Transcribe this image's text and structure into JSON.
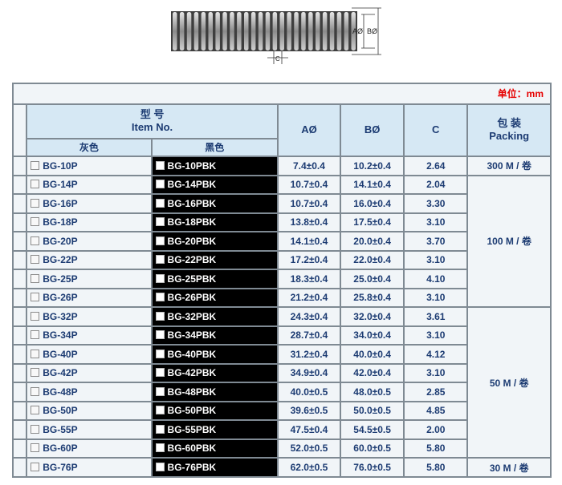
{
  "drawing": {
    "label_a": "AØ",
    "label_b": "BØ",
    "label_c": "C"
  },
  "table": {
    "unit": "单位：mm",
    "header": {
      "item_title_cn": "型  号",
      "item_title_en": "Item No.",
      "gray": "灰色",
      "black": "黑色",
      "a": "AØ",
      "b": "BØ",
      "c": "C",
      "packing_cn": "包  装",
      "packing_en": "Packing"
    },
    "rows": [
      {
        "gray": "BG-10P",
        "black": "BG-10PBK",
        "a": "7.4±0.4",
        "b": "10.2±0.4",
        "c": "2.64"
      },
      {
        "gray": "BG-14P",
        "black": "BG-14PBK",
        "a": "10.7±0.4",
        "b": "14.1±0.4",
        "c": "2.04"
      },
      {
        "gray": "BG-16P",
        "black": "BG-16PBK",
        "a": "10.7±0.4",
        "b": "16.0±0.4",
        "c": "3.30"
      },
      {
        "gray": "BG-18P",
        "black": "BG-18PBK",
        "a": "13.8±0.4",
        "b": "17.5±0.4",
        "c": "3.10"
      },
      {
        "gray": "BG-20P",
        "black": "BG-20PBK",
        "a": "14.1±0.4",
        "b": "20.0±0.4",
        "c": "3.70"
      },
      {
        "gray": "BG-22P",
        "black": "BG-22PBK",
        "a": "17.2±0.4",
        "b": "22.0±0.4",
        "c": "3.10"
      },
      {
        "gray": "BG-25P",
        "black": "BG-25PBK",
        "a": "18.3±0.4",
        "b": "25.0±0.4",
        "c": "4.10"
      },
      {
        "gray": "BG-26P",
        "black": "BG-26PBK",
        "a": "21.2±0.4",
        "b": "25.8±0.4",
        "c": "3.10"
      },
      {
        "gray": "BG-32P",
        "black": "BG-32PBK",
        "a": "24.3±0.4",
        "b": "32.0±0.4",
        "c": "3.61"
      },
      {
        "gray": "BG-34P",
        "black": "BG-34PBK",
        "a": "28.7±0.4",
        "b": "34.0±0.4",
        "c": "3.10"
      },
      {
        "gray": "BG-40P",
        "black": "BG-40PBK",
        "a": "31.2±0.4",
        "b": "40.0±0.4",
        "c": "4.12"
      },
      {
        "gray": "BG-42P",
        "black": "BG-42PBK",
        "a": "34.9±0.4",
        "b": "42.0±0.4",
        "c": "3.10"
      },
      {
        "gray": "BG-48P",
        "black": "BG-48PBK",
        "a": "40.0±0.5",
        "b": "48.0±0.5",
        "c": "2.85"
      },
      {
        "gray": "BG-50P",
        "black": "BG-50PBK",
        "a": "39.6±0.5",
        "b": "50.0±0.5",
        "c": "4.85"
      },
      {
        "gray": "BG-55P",
        "black": "BG-55PBK",
        "a": "47.5±0.4",
        "b": "54.5±0.5",
        "c": "2.00"
      },
      {
        "gray": "BG-60P",
        "black": "BG-60PBK",
        "a": "52.0±0.5",
        "b": "60.0±0.5",
        "c": "5.80"
      },
      {
        "gray": "BG-76P",
        "black": "BG-76PBK",
        "a": "62.0±0.5",
        "b": "76.0±0.5",
        "c": "5.80"
      }
    ],
    "packing": [
      {
        "label": "300 M / 卷",
        "start": 0,
        "span": 1
      },
      {
        "label": "100 M / 卷",
        "start": 1,
        "span": 7
      },
      {
        "label": "50 M / 卷",
        "start": 8,
        "span": 8
      },
      {
        "label": "30 M / 卷",
        "start": 16,
        "span": 1
      }
    ]
  },
  "colors": {
    "header_bg": "#d6e8f4",
    "cell_bg": "#f1f5f8",
    "border": "#7f8a93",
    "text": "#1c3b72",
    "unit_text": "#e60000",
    "black_cell": "#000000"
  }
}
